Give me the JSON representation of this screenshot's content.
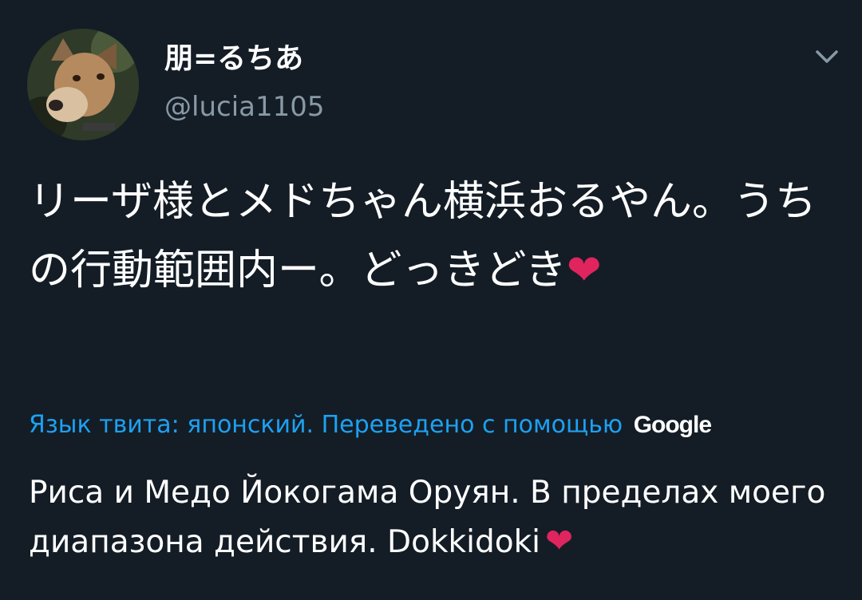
{
  "tweet": {
    "author": {
      "display_name": "朋=るちあ",
      "handle": "@lucia1105",
      "avatar_icon": "dog-avatar"
    },
    "menu_icon": "chevron-down-icon",
    "text": "リーザ様とメドちゃん横浜おるやん。うちの行動範囲内ー。どっきどき",
    "text_emoji": "❤",
    "translation_note": "Язык твита: японский. Переведено с помощью",
    "translation_provider": "Google",
    "translated_text": "Риса и Медо Йокогама Оруян. В пределах моего диапазона действия. Dokkidoki",
    "translated_emoji": "❤"
  },
  "colors": {
    "background": "#141d26",
    "primary_text": "#ffffff",
    "secondary_text": "#8899a6",
    "link": "#1da1f2",
    "heart": "#e0245e"
  }
}
